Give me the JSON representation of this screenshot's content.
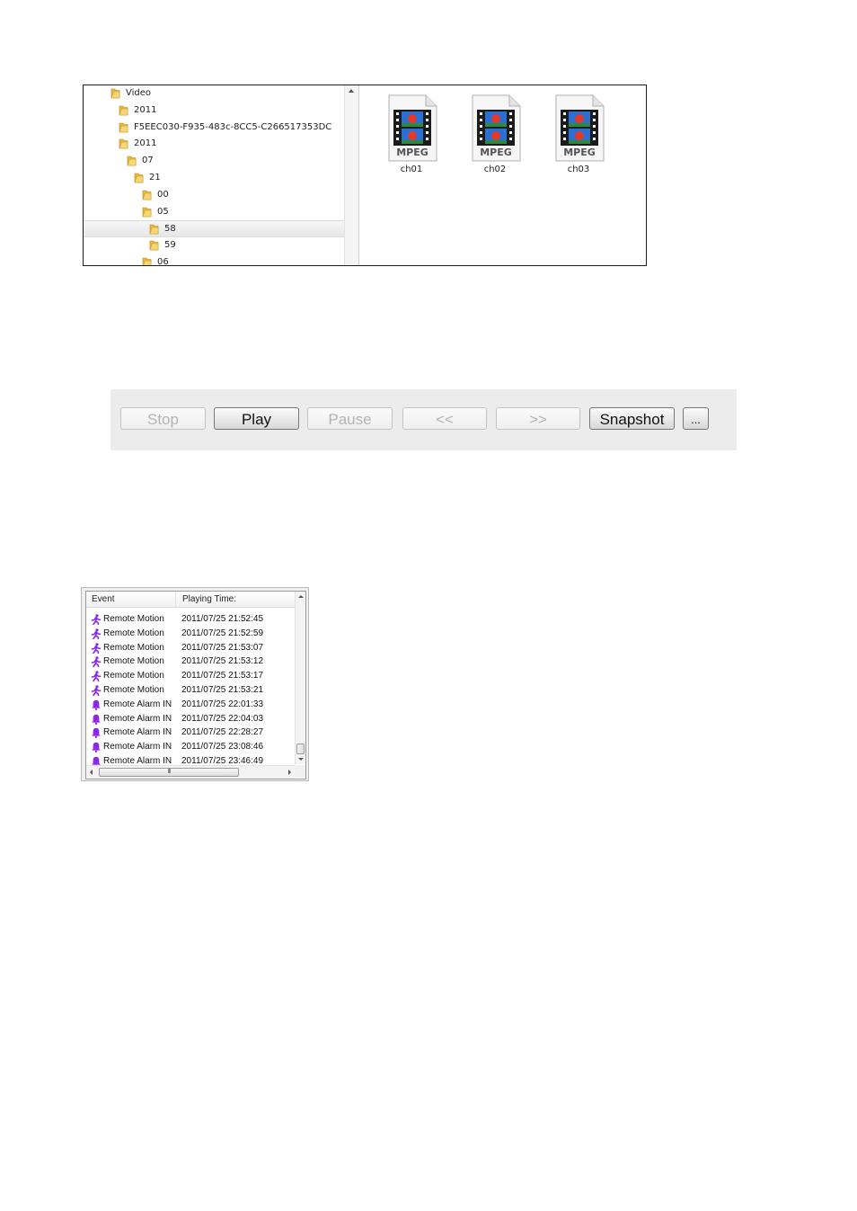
{
  "explorer": {
    "tree": [
      {
        "label": "Video",
        "depth": 0,
        "selected": false
      },
      {
        "label": "2011",
        "depth": 1,
        "selected": false
      },
      {
        "label": "F5EEC030-F935-483c-8CC5-C266517353DC",
        "depth": 1,
        "selected": false
      },
      {
        "label": "2011",
        "depth": 2,
        "selected": false
      },
      {
        "label": "07",
        "depth": 3,
        "selected": false
      },
      {
        "label": "21",
        "depth": 4,
        "selected": false
      },
      {
        "label": "00",
        "depth": 5,
        "selected": false
      },
      {
        "label": "05",
        "depth": 5,
        "selected": false
      },
      {
        "label": "58",
        "depth": 6,
        "selected": true
      },
      {
        "label": "59",
        "depth": 6,
        "selected": false
      },
      {
        "label": "06",
        "depth": 5,
        "selected": false
      }
    ],
    "files": [
      {
        "name": "ch01",
        "icon": "mpeg-video-file-icon",
        "badge": "MPEG"
      },
      {
        "name": "ch02",
        "icon": "mpeg-video-file-icon",
        "badge": "MPEG"
      },
      {
        "name": "ch03",
        "icon": "mpeg-video-file-icon",
        "badge": "MPEG"
      }
    ]
  },
  "toolbar": {
    "stop_label": "Stop",
    "play_label": "Play",
    "pause_label": "Pause",
    "rewind_label": "<<",
    "forward_label": ">>",
    "snapshot_label": "Snapshot",
    "more_label": "..."
  },
  "event_list": {
    "headers": {
      "event": "Event",
      "time": "Playing Time:"
    },
    "rows": [
      {
        "event": "Remote Motion",
        "time": "2011/07/25 21:52:45",
        "icon": "motion-person-icon"
      },
      {
        "event": "Remote Motion",
        "time": "2011/07/25 21:52:59",
        "icon": "motion-person-icon"
      },
      {
        "event": "Remote Motion",
        "time": "2011/07/25 21:53:07",
        "icon": "motion-person-icon"
      },
      {
        "event": "Remote Motion",
        "time": "2011/07/25 21:53:12",
        "icon": "motion-person-icon"
      },
      {
        "event": "Remote Motion",
        "time": "2011/07/25 21:53:17",
        "icon": "motion-person-icon"
      },
      {
        "event": "Remote Motion",
        "time": "2011/07/25 21:53:21",
        "icon": "motion-person-icon"
      },
      {
        "event": "Remote Alarm IN",
        "time": "2011/07/25 22:01:33",
        "icon": "alarm-bell-icon"
      },
      {
        "event": "Remote Alarm IN",
        "time": "2011/07/25 22:04:03",
        "icon": "alarm-bell-icon"
      },
      {
        "event": "Remote Alarm IN",
        "time": "2011/07/25 22:28:27",
        "icon": "alarm-bell-icon"
      },
      {
        "event": "Remote Alarm IN",
        "time": "2011/07/25 23:08:46",
        "icon": "alarm-bell-icon"
      },
      {
        "event": "Remote Alarm IN",
        "time": "2011/07/25 23:46:49",
        "icon": "alarm-bell-icon"
      }
    ],
    "hscroll_grip": "III"
  },
  "colors": {
    "event_icon": "#8a2be2",
    "folder": "#e8b83a"
  }
}
